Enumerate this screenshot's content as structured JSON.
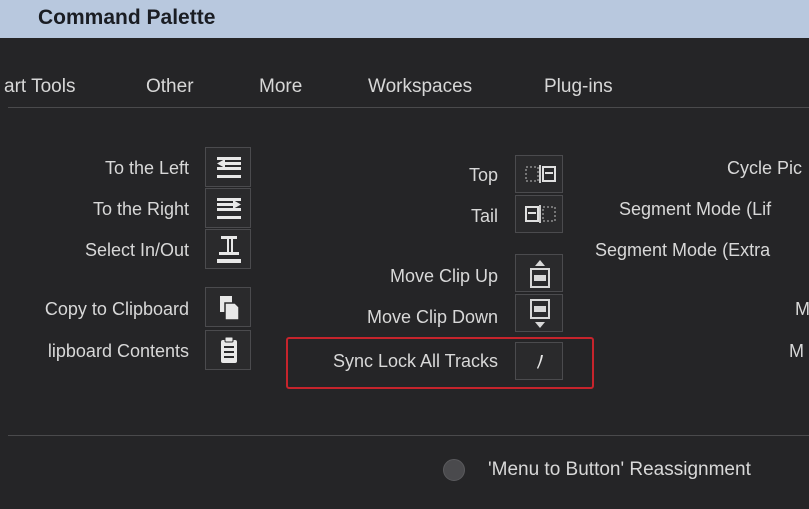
{
  "window": {
    "title": "Command Palette"
  },
  "tabs": [
    {
      "label": "art Tools"
    },
    {
      "label": "Other"
    },
    {
      "label": "More"
    },
    {
      "label": "Workspaces"
    },
    {
      "label": "Plug-ins"
    }
  ],
  "commands": {
    "to_left": {
      "label": "To the Left",
      "icon": "lift-left-icon"
    },
    "to_right": {
      "label": "To the Right",
      "icon": "lift-right-icon"
    },
    "select_in_out": {
      "label": "Select In/Out",
      "icon": "select-in-out-icon"
    },
    "copy_clipboard": {
      "label": "Copy to Clipboard",
      "icon": "copy-icon"
    },
    "clipboard_contents": {
      "label": "lipboard Contents",
      "icon": "clipboard-icon"
    },
    "top": {
      "label": "Top",
      "icon": "top-icon"
    },
    "tail": {
      "label": "Tail",
      "icon": "tail-icon"
    },
    "move_clip_up": {
      "label": "Move Clip Up",
      "icon": "move-clip-up-icon"
    },
    "move_clip_down": {
      "label": "Move Clip Down",
      "icon": "move-clip-down-icon"
    },
    "sync_lock": {
      "label": "Sync Lock All Tracks",
      "icon": "sync-lock-icon",
      "highlighted": true
    },
    "cycle": {
      "label": "Cycle Pic"
    },
    "segment_lift": {
      "label": "Segment Mode (Lif"
    },
    "segment_extract": {
      "label": "Segment Mode (Extra"
    },
    "m1": {
      "label": "M"
    },
    "m2": {
      "label": "M"
    }
  },
  "footer": {
    "radio_label": "'Menu to Button' Reassignment"
  },
  "colors": {
    "title_bar": "#b8c8de",
    "highlight": "#c6242c",
    "background": "#252527"
  }
}
